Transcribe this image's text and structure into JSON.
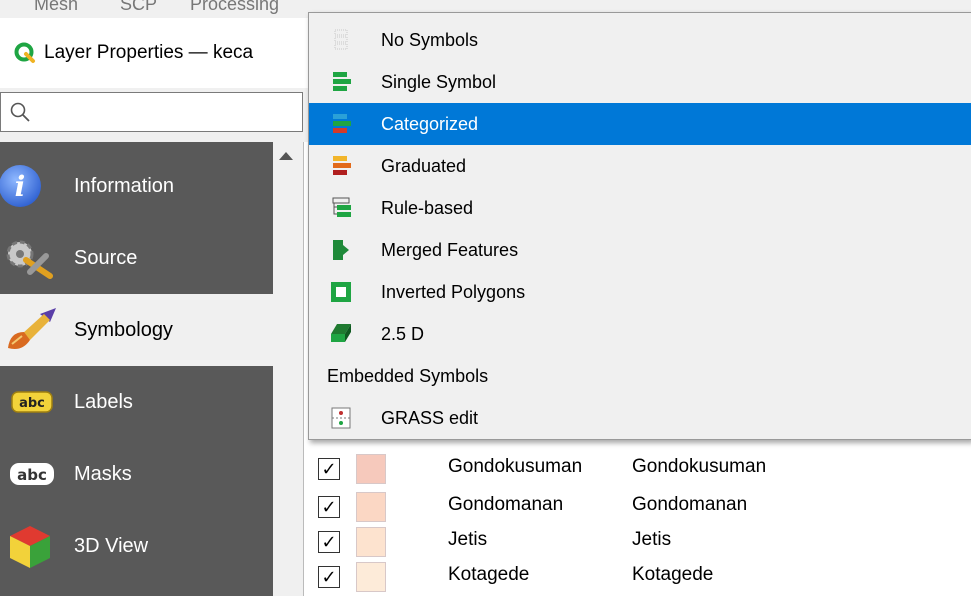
{
  "menubar": {
    "items": [
      "Mesh",
      "SCP",
      "Processing"
    ]
  },
  "window": {
    "title": "Layer Properties — keca"
  },
  "search": {
    "placeholder": ""
  },
  "sidebar": {
    "items": [
      {
        "label": "Information",
        "icon": "information-icon"
      },
      {
        "label": "Source",
        "icon": "source-icon"
      },
      {
        "label": "Symbology",
        "icon": "symbology-icon",
        "selected": true
      },
      {
        "label": "Labels",
        "icon": "labels-icon"
      },
      {
        "label": "Masks",
        "icon": "masks-icon"
      },
      {
        "label": "3D View",
        "icon": "3d-view-icon"
      }
    ]
  },
  "renderer_menu": {
    "items": [
      {
        "label": "No Symbols",
        "icon": "no-symbols-icon"
      },
      {
        "label": "Single Symbol",
        "icon": "single-symbol-icon"
      },
      {
        "label": "Categorized",
        "icon": "categorized-icon",
        "highlighted": true
      },
      {
        "label": "Graduated",
        "icon": "graduated-icon"
      },
      {
        "label": "Rule-based",
        "icon": "rule-based-icon"
      },
      {
        "label": "Merged Features",
        "icon": "merged-features-icon"
      },
      {
        "label": "Inverted Polygons",
        "icon": "inverted-polygons-icon"
      },
      {
        "label": "2.5 D",
        "icon": "2-5d-icon"
      },
      {
        "label": "Embedded Symbols",
        "section": true
      },
      {
        "label": "GRASS edit",
        "icon": "grass-edit-icon"
      }
    ]
  },
  "categories": {
    "rows": [
      {
        "checked": "✓",
        "color": "#f6c9bc",
        "value": "Gondokusuman",
        "legend": "Gondokusuman"
      },
      {
        "checked": "✓",
        "color": "#fbd7c4",
        "value": "Gondomanan",
        "legend": "Gondomanan"
      },
      {
        "checked": "✓",
        "color": "#fde3cf",
        "value": "Jetis",
        "legend": "Jetis"
      },
      {
        "checked": "✓",
        "color": "#fdebd9",
        "value": "Kotagede",
        "legend": "Kotagede"
      }
    ]
  },
  "colors": {
    "highlight": "#0078d7",
    "sidebar": "#595959",
    "qgis_green": "#1fa543"
  }
}
